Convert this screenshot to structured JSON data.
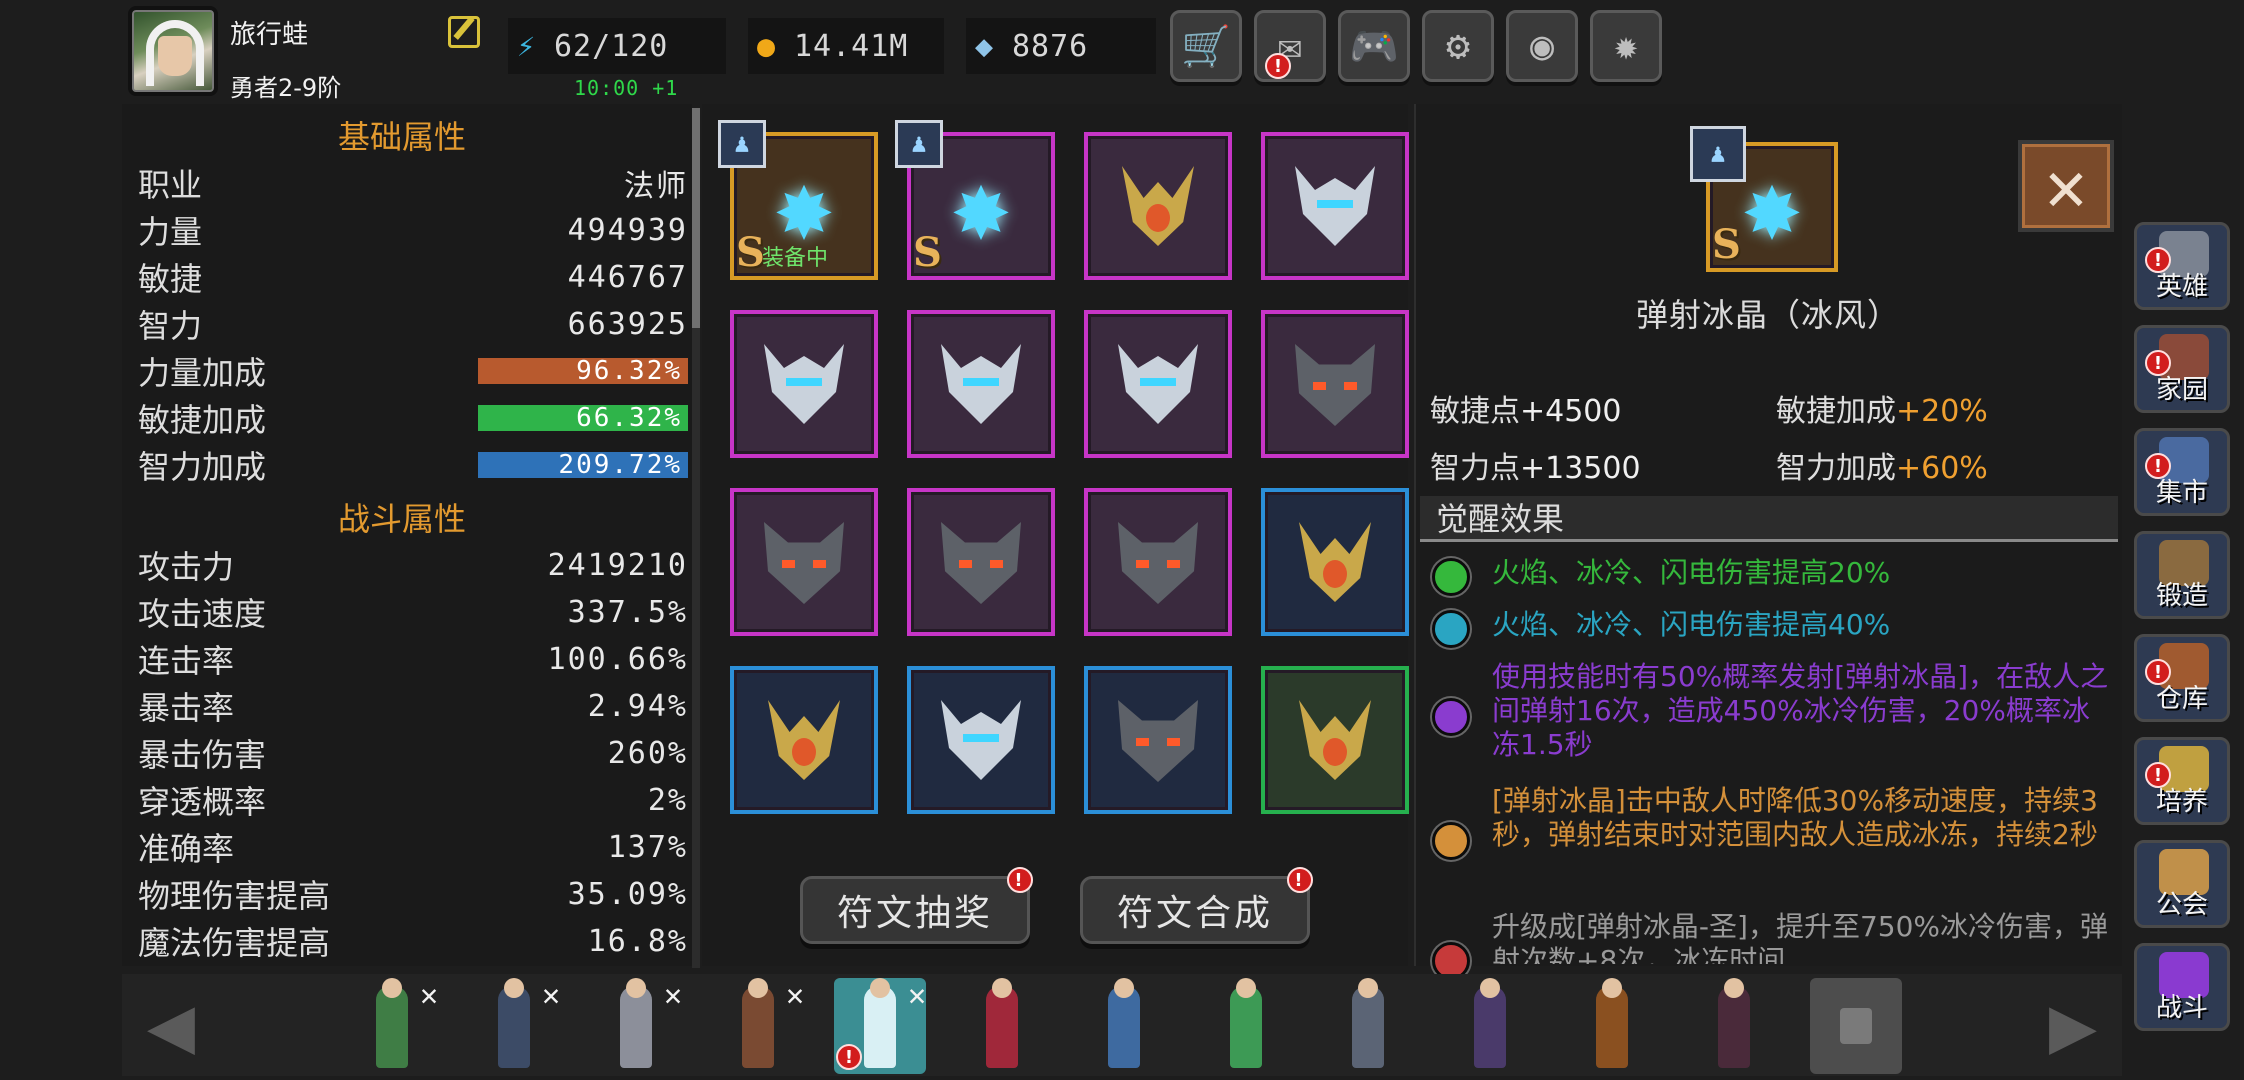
{
  "player": {
    "name": "旅行蛙",
    "rank": "勇者2-9阶"
  },
  "resources": {
    "energy": "62/120",
    "gold": "14.41M",
    "gems": "8876",
    "energy_timer": "10:00 +1"
  },
  "top_buttons": [
    {
      "icon": "cart-icon",
      "glyph": "🛒",
      "badge": ""
    },
    {
      "icon": "mail-icon",
      "glyph": "✉",
      "badge": "!"
    },
    {
      "icon": "gamepad-icon",
      "glyph": "🎮",
      "badge": ""
    },
    {
      "icon": "gear-icon",
      "glyph": "⚙",
      "badge": ""
    },
    {
      "icon": "color-wheel-icon",
      "glyph": "◉",
      "badge": ""
    },
    {
      "icon": "fireworks-icon",
      "glyph": "✹",
      "badge": ""
    }
  ],
  "stats": {
    "basic_title": "基础属性",
    "job_label": "职业",
    "job_value": "法师",
    "str_label": "力量",
    "str_value": "494939",
    "agi_label": "敏捷",
    "agi_value": "446767",
    "int_label": "智力",
    "int_value": "663925",
    "str_bonus_label": "力量加成",
    "str_bonus_value": "96.32%",
    "agi_bonus_label": "敏捷加成",
    "agi_bonus_value": "66.32%",
    "int_bonus_label": "智力加成",
    "int_bonus_value": "209.72%",
    "combat_title": "战斗属性",
    "combat": [
      {
        "label": "攻击力",
        "value": "2419210"
      },
      {
        "label": "攻击速度",
        "value": "337.5%"
      },
      {
        "label": "连击率",
        "value": "100.66%"
      },
      {
        "label": "暴击率",
        "value": "2.94%"
      },
      {
        "label": "暴击伤害",
        "value": "260%"
      },
      {
        "label": "穿透概率",
        "value": "2%"
      },
      {
        "label": "准确率",
        "value": "137%"
      },
      {
        "label": "物理伤害提高",
        "value": "35.09%"
      },
      {
        "label": "魔法伤害提高",
        "value": "16.8%"
      }
    ]
  },
  "runes": {
    "rank_letter": "S",
    "equipped_label": "装备中",
    "items": [
      {
        "art": "snowflake",
        "frame": "gold"
      },
      {
        "art": "snowflake",
        "frame": "purple"
      },
      {
        "art": "crown",
        "frame": "purple"
      },
      {
        "art": "helm",
        "frame": "purple"
      },
      {
        "art": "helm",
        "frame": "purple"
      },
      {
        "art": "helm",
        "frame": "purple"
      },
      {
        "art": "helm",
        "frame": "purple"
      },
      {
        "art": "wolf",
        "frame": "purple"
      },
      {
        "art": "wolf",
        "frame": "purple"
      },
      {
        "art": "wolf",
        "frame": "purple"
      },
      {
        "art": "wolf",
        "frame": "purple"
      },
      {
        "art": "crown",
        "frame": "blue"
      },
      {
        "art": "crown",
        "frame": "blue"
      },
      {
        "art": "helm",
        "frame": "blue"
      },
      {
        "art": "wolf",
        "frame": "blue"
      },
      {
        "art": "crown",
        "frame": "green"
      }
    ],
    "lottery_button": "符文抽奖",
    "synth_button": "符文合成"
  },
  "detail": {
    "name": "弹射冰晶（冰风）",
    "attrs": [
      {
        "label": "敏捷点",
        "value": "+4500"
      },
      {
        "label": "敏捷加成",
        "value": "+20%"
      },
      {
        "label": "智力点",
        "value": "+13500"
      },
      {
        "label": "智力加成",
        "value": "+60%"
      }
    ],
    "awaken_title": "觉醒效果",
    "effects": [
      {
        "color": "#35b83c",
        "text": "火焰、冰冷、闪电伤害提高20%"
      },
      {
        "color": "#2aa5c2",
        "text": "火焰、冰冷、闪电伤害提高40%"
      },
      {
        "color": "#8a3ccf",
        "text": "使用技能时有50%概率发射[弹射冰晶]，在敌人之间弹射16次，造成450%冰冷伤害，20%概率冰冻1.5秒"
      },
      {
        "color": "#d4903a",
        "text": "[弹射冰晶]击中敌人时降低30%移动速度，持续3秒，弹射结束时对范围内敌人造成冰冻，持续2秒"
      },
      {
        "color": "#c63a3a",
        "text": "升级成[弹射冰晶-圣]，提升至750%冰冷伤害，弹射次数+8次，冰冻时间"
      }
    ]
  },
  "nav": [
    {
      "label": "英雄",
      "badge": "!",
      "icon": "helmet-icon"
    },
    {
      "label": "家园",
      "badge": "!",
      "icon": "castle-icon"
    },
    {
      "label": "集市",
      "badge": "!",
      "icon": "shop-icon"
    },
    {
      "label": "锻造",
      "badge": "",
      "icon": "anvil-icon"
    },
    {
      "label": "仓库",
      "badge": "!",
      "icon": "chest-icon"
    },
    {
      "label": "培养",
      "badge": "!",
      "icon": "chalice-icon"
    },
    {
      "label": "公会",
      "badge": "",
      "icon": "lion-icon"
    },
    {
      "label": "战斗",
      "badge": "",
      "icon": "portal-icon"
    }
  ],
  "heroes": [
    {
      "name": "elf-archer",
      "color": "#3f7d45",
      "crossed": true
    },
    {
      "name": "dark-knight",
      "color": "#3c4b66",
      "crossed": true
    },
    {
      "name": "silver-swordsman",
      "color": "#8c8f9a",
      "crossed": true
    },
    {
      "name": "amazon",
      "color": "#7a4a32",
      "crossed": true
    },
    {
      "name": "ice-mage",
      "color": "#d9f0f4",
      "crossed": true,
      "selected": true,
      "badge": "!"
    },
    {
      "name": "red-priestess",
      "color": "#a0283a",
      "crossed": false
    },
    {
      "name": "gunner",
      "color": "#3e6aa0",
      "crossed": false
    },
    {
      "name": "druid",
      "color": "#3d9a55",
      "crossed": false
    },
    {
      "name": "sorceress",
      "color": "#5b6475",
      "crossed": false
    },
    {
      "name": "warlock",
      "color": "#4a3a6a",
      "crossed": false
    },
    {
      "name": "dragon-warrior",
      "color": "#8a5020",
      "crossed": false
    },
    {
      "name": "assassin",
      "color": "#4a2a3a",
      "crossed": false
    },
    {
      "name": "locked-slot",
      "color": "#7a7a7a",
      "crossed": false,
      "locked": true
    }
  ]
}
